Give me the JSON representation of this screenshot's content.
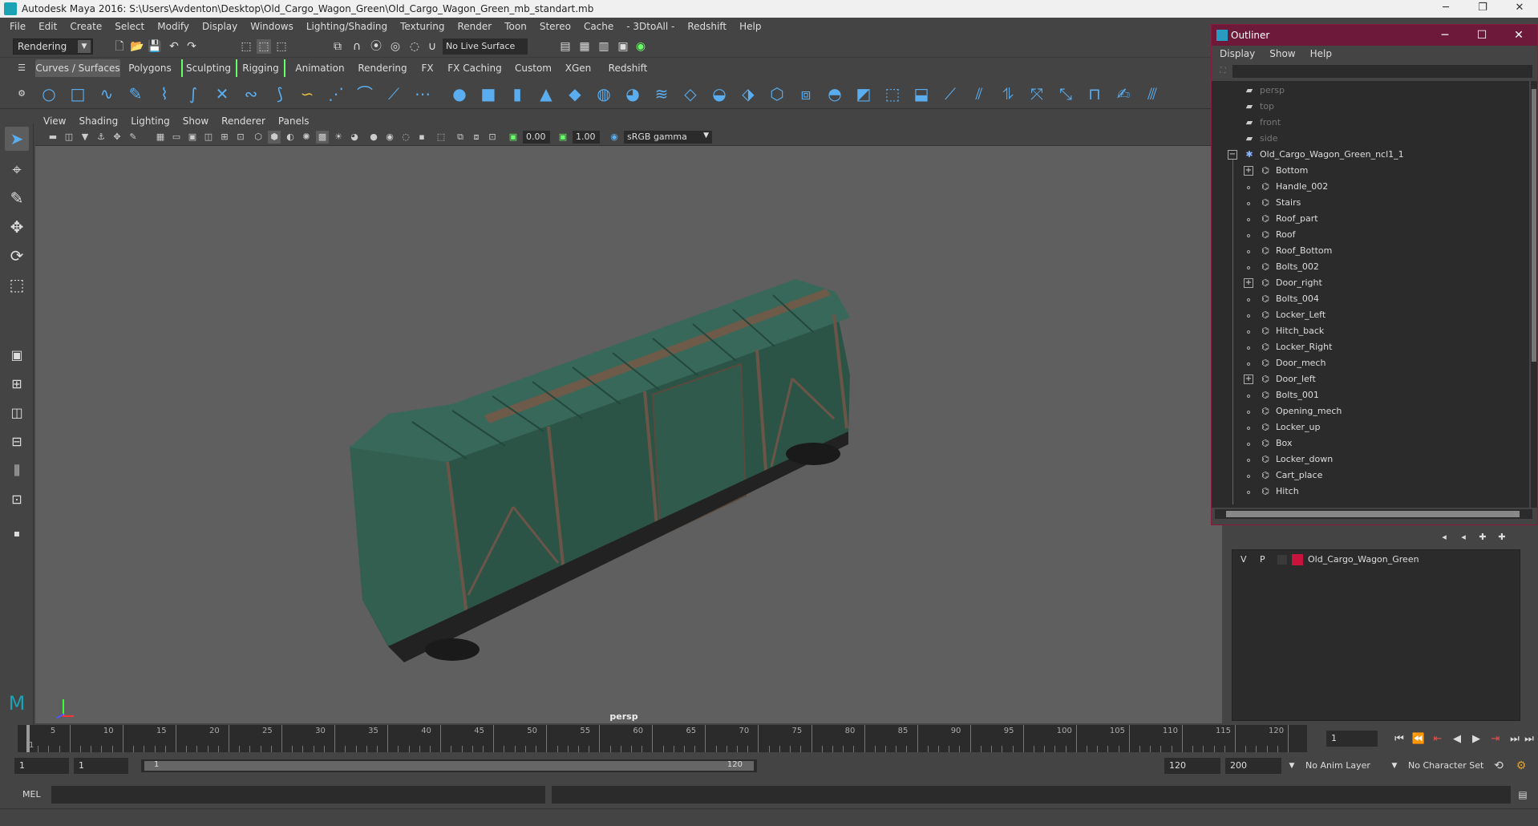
{
  "window": {
    "title": "Autodesk Maya 2016: S:\\Users\\Avdenton\\Desktop\\Old_Cargo_Wagon_Green\\Old_Cargo_Wagon_Green_mb_standart.mb",
    "minimize": "─",
    "maximize": "❐",
    "close": "✕"
  },
  "menubar": [
    "File",
    "Edit",
    "Create",
    "Select",
    "Modify",
    "Display",
    "Windows",
    "Lighting/Shading",
    "Texturing",
    "Render",
    "Toon",
    "Stereo",
    "Cache",
    "- 3DtoAll -",
    "Redshift",
    "Help"
  ],
  "statusline": {
    "mode": "Rendering",
    "live_surface": "No Live Surface"
  },
  "shelf_tabs": [
    "Curves / Surfaces",
    "Polygons",
    "Sculpting",
    "Rigging",
    "Animation",
    "Rendering",
    "FX",
    "FX Caching",
    "Custom",
    "XGen",
    "Redshift"
  ],
  "shelf_active_tab": "Curves / Surfaces",
  "panel_menu": [
    "View",
    "Shading",
    "Lighting",
    "Show",
    "Renderer",
    "Panels"
  ],
  "panel_toolbar": {
    "exposure": "0.00",
    "gamma": "1.00",
    "color_space": "sRGB gamma"
  },
  "viewport": {
    "camera_label": "persp"
  },
  "outliner": {
    "title": "Outliner",
    "menu": [
      "Display",
      "Show",
      "Help"
    ],
    "cameras": [
      "persp",
      "top",
      "front",
      "side"
    ],
    "root": "Old_Cargo_Wagon_Green_ncl1_1",
    "children": [
      {
        "name": "Bottom",
        "expandable": true
      },
      {
        "name": "Handle_002",
        "expandable": false
      },
      {
        "name": "Stairs",
        "expandable": false
      },
      {
        "name": "Roof_part",
        "expandable": false
      },
      {
        "name": "Roof",
        "expandable": false
      },
      {
        "name": "Roof_Bottom",
        "expandable": false
      },
      {
        "name": "Bolts_002",
        "expandable": false
      },
      {
        "name": "Door_right",
        "expandable": true
      },
      {
        "name": "Bolts_004",
        "expandable": false
      },
      {
        "name": "Locker_Left",
        "expandable": false
      },
      {
        "name": "Hitch_back",
        "expandable": false
      },
      {
        "name": "Locker_Right",
        "expandable": false
      },
      {
        "name": "Door_mech",
        "expandable": false
      },
      {
        "name": "Door_left",
        "expandable": true
      },
      {
        "name": "Bolts_001",
        "expandable": false
      },
      {
        "name": "Opening_mech",
        "expandable": false
      },
      {
        "name": "Locker_up",
        "expandable": false
      },
      {
        "name": "Box",
        "expandable": false
      },
      {
        "name": "Locker_down",
        "expandable": false
      },
      {
        "name": "Cart_place",
        "expandable": false
      },
      {
        "name": "Hitch",
        "expandable": false
      }
    ]
  },
  "layer_editor": {
    "layer": {
      "v": "V",
      "p": "P",
      "name": "Old_Cargo_Wagon_Green",
      "color": "#c8143c"
    }
  },
  "timeline": {
    "ticks": [
      5,
      10,
      15,
      20,
      25,
      30,
      35,
      40,
      45,
      50,
      55,
      60,
      65,
      70,
      75,
      80,
      85,
      90,
      95,
      100,
      105,
      110,
      115,
      120
    ],
    "start_label": "1",
    "current_frame": "1"
  },
  "range": {
    "start": "1",
    "playback_start": "1",
    "slider_start": "1",
    "slider_end": "120",
    "playback_end": "120",
    "end": "200",
    "anim_layer": "No Anim Layer",
    "character_set": "No Character Set"
  },
  "cmdline": {
    "label": "MEL"
  },
  "colors": {
    "outliner_title": "#6d1a3a",
    "accent": "#5aaef0",
    "maya_teal": "#1ba2b5"
  }
}
